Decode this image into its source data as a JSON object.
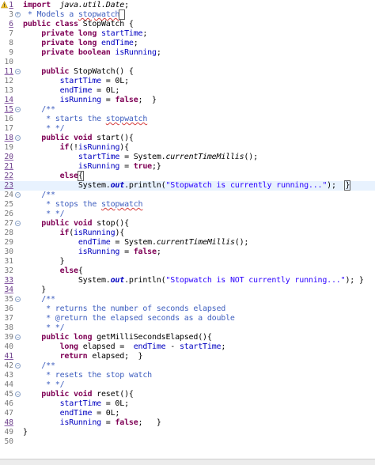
{
  "editor": {
    "lines": [
      {
        "num": "1",
        "mark": true,
        "warn": true,
        "fold": "",
        "tokens": [
          [
            "kw",
            "import"
          ],
          [
            "",
            "  "
          ],
          [
            "it",
            "java.util.Date"
          ],
          [
            "",
            ";"
          ]
        ]
      },
      {
        "num": "3",
        "fold": "plus",
        "tokens": [
          [
            "com",
            " * Models a "
          ],
          [
            "com-sq",
            "stopwatch"
          ],
          [
            "com-cur",
            " "
          ]
        ]
      },
      {
        "num": "6",
        "mark": true,
        "fold": "",
        "tokens": [
          [
            "kw",
            "public class"
          ],
          [
            "",
            " StopWatch {"
          ]
        ]
      },
      {
        "num": "7",
        "fold": "",
        "tokens": [
          [
            "",
            "    "
          ],
          [
            "kw",
            "private long"
          ],
          [
            "",
            " "
          ],
          [
            "field",
            "startTime"
          ],
          [
            "",
            ";"
          ]
        ]
      },
      {
        "num": "8",
        "fold": "",
        "tokens": [
          [
            "",
            "    "
          ],
          [
            "kw",
            "private long"
          ],
          [
            "",
            " "
          ],
          [
            "field",
            "endTime"
          ],
          [
            "",
            ";"
          ]
        ]
      },
      {
        "num": "9",
        "fold": "",
        "tokens": [
          [
            "",
            "    "
          ],
          [
            "kw",
            "private boolean"
          ],
          [
            "",
            " "
          ],
          [
            "field",
            "isRunning"
          ],
          [
            "",
            ";"
          ]
        ]
      },
      {
        "num": "10",
        "fold": "",
        "tokens": []
      },
      {
        "num": "11",
        "mark": true,
        "fold": "minus",
        "tokens": [
          [
            "",
            "    "
          ],
          [
            "kw",
            "public"
          ],
          [
            "",
            " StopWatch() {"
          ]
        ]
      },
      {
        "num": "12",
        "fold": "",
        "tokens": [
          [
            "",
            "        "
          ],
          [
            "field",
            "startTime"
          ],
          [
            "",
            " = 0L;"
          ]
        ]
      },
      {
        "num": "13",
        "fold": "",
        "tokens": [
          [
            "",
            "        "
          ],
          [
            "field",
            "endTime"
          ],
          [
            "",
            " = 0L;"
          ]
        ]
      },
      {
        "num": "14",
        "mark": true,
        "fold": "",
        "tokens": [
          [
            "",
            "        "
          ],
          [
            "field",
            "isRunning"
          ],
          [
            "",
            " = "
          ],
          [
            "kw",
            "false"
          ],
          [
            "",
            ";  }"
          ]
        ]
      },
      {
        "num": "15",
        "mark": true,
        "fold": "minus",
        "tokens": [
          [
            "",
            "    "
          ],
          [
            "com",
            "/**"
          ]
        ]
      },
      {
        "num": "16",
        "fold": "",
        "tokens": [
          [
            "",
            "     "
          ],
          [
            "com",
            "* starts the "
          ],
          [
            "com-sq",
            "stopwatch"
          ]
        ]
      },
      {
        "num": "17",
        "fold": "",
        "tokens": [
          [
            "",
            "     "
          ],
          [
            "com",
            "* */"
          ]
        ]
      },
      {
        "num": "18",
        "mark": true,
        "fold": "minus",
        "tokens": [
          [
            "",
            "    "
          ],
          [
            "kw",
            "public void"
          ],
          [
            "",
            " start(){"
          ]
        ]
      },
      {
        "num": "19",
        "fold": "",
        "tokens": [
          [
            "",
            "        "
          ],
          [
            "kw",
            "if"
          ],
          [
            "",
            "(!"
          ],
          [
            "field",
            "isRunning"
          ],
          [
            "",
            "){"
          ]
        ]
      },
      {
        "num": "20",
        "mark": true,
        "fold": "",
        "tokens": [
          [
            "",
            "            "
          ],
          [
            "field",
            "startTime"
          ],
          [
            "",
            " = System."
          ],
          [
            "itbold",
            "currentTimeMillis"
          ],
          [
            "",
            "();"
          ]
        ]
      },
      {
        "num": "21",
        "mark": true,
        "fold": "",
        "tokens": [
          [
            "",
            "            "
          ],
          [
            "field",
            "isRunning"
          ],
          [
            "",
            " = "
          ],
          [
            "kw",
            "true"
          ],
          [
            "",
            ";}"
          ]
        ]
      },
      {
        "num": "22",
        "mark": true,
        "fold": "",
        "tokens": [
          [
            "",
            "        "
          ],
          [
            "kw",
            "else"
          ],
          [
            "cur",
            "{"
          ]
        ]
      },
      {
        "num": "23",
        "mark": true,
        "current": true,
        "fold": "",
        "tokens": [
          [
            "",
            "            System."
          ],
          [
            "sfield",
            "out"
          ],
          [
            "",
            ".println("
          ],
          [
            "str",
            "\"Stopwatch is currently running...\""
          ],
          [
            "",
            ");  "
          ],
          [
            "cur",
            "}"
          ],
          [
            "",
            "        }"
          ]
        ]
      },
      {
        "num": "24",
        "fold": "minus",
        "tokens": [
          [
            "",
            "    "
          ],
          [
            "com",
            "/**"
          ]
        ]
      },
      {
        "num": "25",
        "fold": "",
        "tokens": [
          [
            "",
            "     "
          ],
          [
            "com",
            "* stops the "
          ],
          [
            "com-sq",
            "stopwatch"
          ]
        ]
      },
      {
        "num": "26",
        "fold": "",
        "tokens": [
          [
            "",
            "     "
          ],
          [
            "com",
            "* */"
          ]
        ]
      },
      {
        "num": "27",
        "fold": "minus",
        "tokens": [
          [
            "",
            "    "
          ],
          [
            "kw",
            "public void"
          ],
          [
            "",
            " stop(){"
          ]
        ]
      },
      {
        "num": "28",
        "fold": "",
        "tokens": [
          [
            "",
            "        "
          ],
          [
            "kw",
            "if"
          ],
          [
            "",
            "("
          ],
          [
            "field",
            "isRunning"
          ],
          [
            "",
            "){"
          ]
        ]
      },
      {
        "num": "29",
        "fold": "",
        "tokens": [
          [
            "",
            "            "
          ],
          [
            "field",
            "endTime"
          ],
          [
            "",
            " = System."
          ],
          [
            "itbold",
            "currentTimeMillis"
          ],
          [
            "",
            "();"
          ]
        ]
      },
      {
        "num": "30",
        "fold": "",
        "tokens": [
          [
            "",
            "            "
          ],
          [
            "field",
            "isRunning"
          ],
          [
            "",
            " = "
          ],
          [
            "kw",
            "false"
          ],
          [
            "",
            ";"
          ]
        ]
      },
      {
        "num": "31",
        "fold": "",
        "tokens": [
          [
            "",
            "        }"
          ]
        ]
      },
      {
        "num": "32",
        "fold": "",
        "tokens": [
          [
            "",
            "        "
          ],
          [
            "kw",
            "else"
          ],
          [
            "",
            "{"
          ]
        ]
      },
      {
        "num": "33",
        "mark": true,
        "fold": "",
        "tokens": [
          [
            "",
            "            System."
          ],
          [
            "sfield",
            "out"
          ],
          [
            "",
            ".println("
          ],
          [
            "str",
            "\"Stopwatch is NOT currently running...\""
          ],
          [
            "",
            "); }"
          ]
        ]
      },
      {
        "num": "34",
        "mark": true,
        "fold": "",
        "tokens": [
          [
            "",
            "    }"
          ]
        ]
      },
      {
        "num": "35",
        "fold": "minus",
        "tokens": [
          [
            "",
            "    "
          ],
          [
            "com",
            "/**"
          ]
        ]
      },
      {
        "num": "36",
        "fold": "",
        "tokens": [
          [
            "",
            "     "
          ],
          [
            "com",
            "* returns the number of seconds elapsed"
          ]
        ]
      },
      {
        "num": "37",
        "fold": "",
        "tokens": [
          [
            "",
            "     "
          ],
          [
            "com",
            "* @return the elapsed seconds as a double"
          ]
        ]
      },
      {
        "num": "38",
        "fold": "",
        "tokens": [
          [
            "",
            "     "
          ],
          [
            "com",
            "* */"
          ]
        ]
      },
      {
        "num": "39",
        "fold": "minus",
        "tokens": [
          [
            "",
            "    "
          ],
          [
            "kw",
            "public long"
          ],
          [
            "",
            " getMilliSecondsElapsed(){"
          ]
        ]
      },
      {
        "num": "40",
        "fold": "",
        "tokens": [
          [
            "",
            "        "
          ],
          [
            "kw",
            "long"
          ],
          [
            "",
            " elapsed =  "
          ],
          [
            "field",
            "endTime"
          ],
          [
            "",
            " - "
          ],
          [
            "field",
            "startTime"
          ],
          [
            "",
            ";"
          ]
        ]
      },
      {
        "num": "41",
        "mark": true,
        "fold": "",
        "tokens": [
          [
            "",
            "        "
          ],
          [
            "kw",
            "return"
          ],
          [
            "",
            " elapsed;  }"
          ]
        ]
      },
      {
        "num": "42",
        "fold": "minus",
        "tokens": [
          [
            "",
            "    "
          ],
          [
            "com",
            "/**"
          ]
        ]
      },
      {
        "num": "43",
        "fold": "",
        "tokens": [
          [
            "",
            "     "
          ],
          [
            "com",
            "* resets the stop watch"
          ]
        ]
      },
      {
        "num": "44",
        "fold": "",
        "tokens": [
          [
            "",
            "     "
          ],
          [
            "com",
            "* */"
          ]
        ]
      },
      {
        "num": "45",
        "fold": "minus",
        "tokens": [
          [
            "",
            "    "
          ],
          [
            "kw",
            "public void"
          ],
          [
            "",
            " reset(){"
          ]
        ]
      },
      {
        "num": "46",
        "fold": "",
        "tokens": [
          [
            "",
            "        "
          ],
          [
            "field",
            "startTime"
          ],
          [
            "",
            " = 0L;"
          ]
        ]
      },
      {
        "num": "47",
        "fold": "",
        "tokens": [
          [
            "",
            "        "
          ],
          [
            "field",
            "endTime"
          ],
          [
            "",
            " = 0L;"
          ]
        ]
      },
      {
        "num": "48",
        "mark": true,
        "fold": "",
        "tokens": [
          [
            "",
            "        "
          ],
          [
            "field",
            "isRunning"
          ],
          [
            "",
            " = "
          ],
          [
            "kw",
            "false"
          ],
          [
            "",
            ";   }"
          ]
        ]
      },
      {
        "num": "49",
        "fold": "",
        "tokens": [
          [
            "",
            "}"
          ]
        ]
      },
      {
        "num": "50",
        "fold": "",
        "tokens": []
      }
    ]
  }
}
